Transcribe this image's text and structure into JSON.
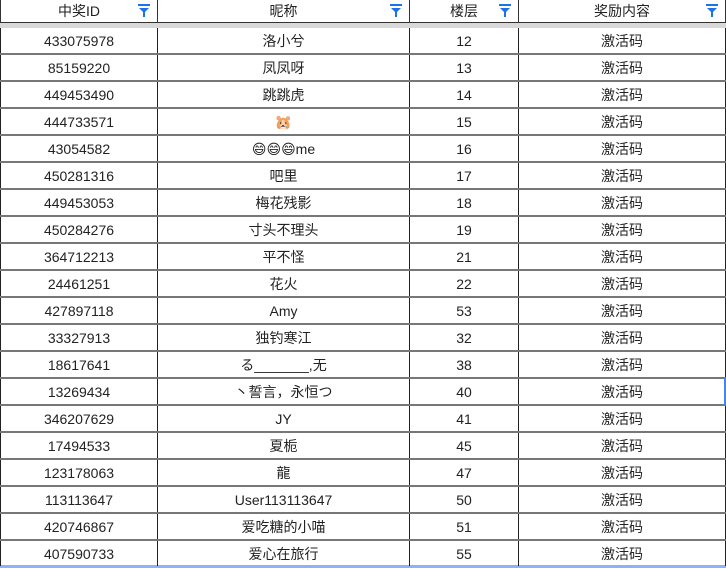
{
  "table": {
    "columns": [
      {
        "label": "中奖ID",
        "filter_icon": "filter-icon"
      },
      {
        "label": "昵称",
        "filter_icon": "filter-icon"
      },
      {
        "label": "楼层",
        "filter_icon": "filter-icon"
      },
      {
        "label": "奖励内容",
        "filter_icon": "filter-icon"
      }
    ],
    "rows": [
      [
        "433075978",
        "洛小兮",
        "12",
        "激活码"
      ],
      [
        "85159220",
        "凤凤呀",
        "13",
        "激活码"
      ],
      [
        "449453490",
        "跳跳虎",
        "14",
        "激活码"
      ],
      [
        "444733571",
        "🐹",
        "15",
        "激活码"
      ],
      [
        "43054582",
        "😄😄😄me",
        "16",
        "激活码"
      ],
      [
        "450281316",
        "吧里",
        "17",
        "激活码"
      ],
      [
        "449453053",
        "梅花残影",
        "18",
        "激活码"
      ],
      [
        "450284276",
        "寸头不理头",
        "19",
        "激活码"
      ],
      [
        "364712213",
        "平不怪",
        "21",
        "激活码"
      ],
      [
        "24461251",
        "花火",
        "22",
        "激活码"
      ],
      [
        "427897118",
        "Amy",
        "53",
        "激活码"
      ],
      [
        "33327913",
        "独钓寒江",
        "32",
        "激活码"
      ],
      [
        "18617641",
        "る_______,无",
        "38",
        "激活码"
      ],
      [
        "13269434",
        "丶誓言，永恒つ",
        "40",
        "激活码"
      ],
      [
        "346207629",
        "JY",
        "41",
        "激活码"
      ],
      [
        "17494533",
        "夏栀",
        "45",
        "激活码"
      ],
      [
        "123178063",
        "龍",
        "47",
        "激活码"
      ],
      [
        "113113647",
        "User113113647",
        "50",
        "激活码"
      ],
      [
        "420746867",
        "爱吃糖的小喵",
        "51",
        "激活码"
      ],
      [
        "407590733",
        "爱心在旅行",
        "55",
        "激活码"
      ]
    ]
  },
  "colors": {
    "filter_icon": "#1a73e8",
    "selection": "#4285f4"
  }
}
